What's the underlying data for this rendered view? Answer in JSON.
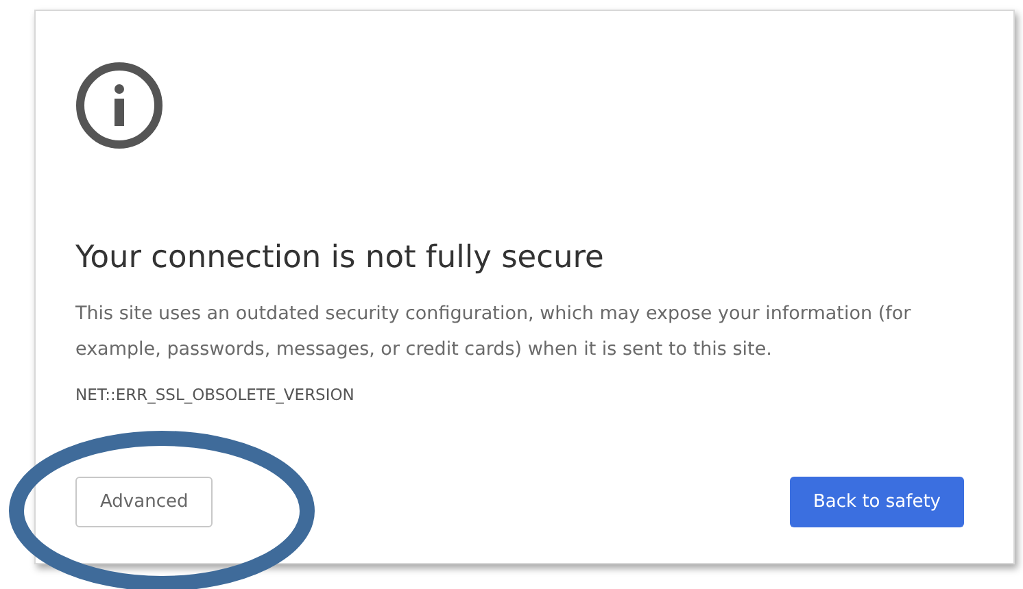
{
  "title": "Your connection is not fully secure",
  "message": "This site uses an outdated security configuration, which may expose your information (for example, passwords, messages, or credit cards) when it is sent to this site.",
  "error_code": "NET::ERR_SSL_OBSOLETE_VERSION",
  "buttons": [
    {
      "label": "Advanced",
      "kind": "secondary"
    },
    {
      "label": "Back to safety",
      "kind": "primary"
    }
  ]
}
